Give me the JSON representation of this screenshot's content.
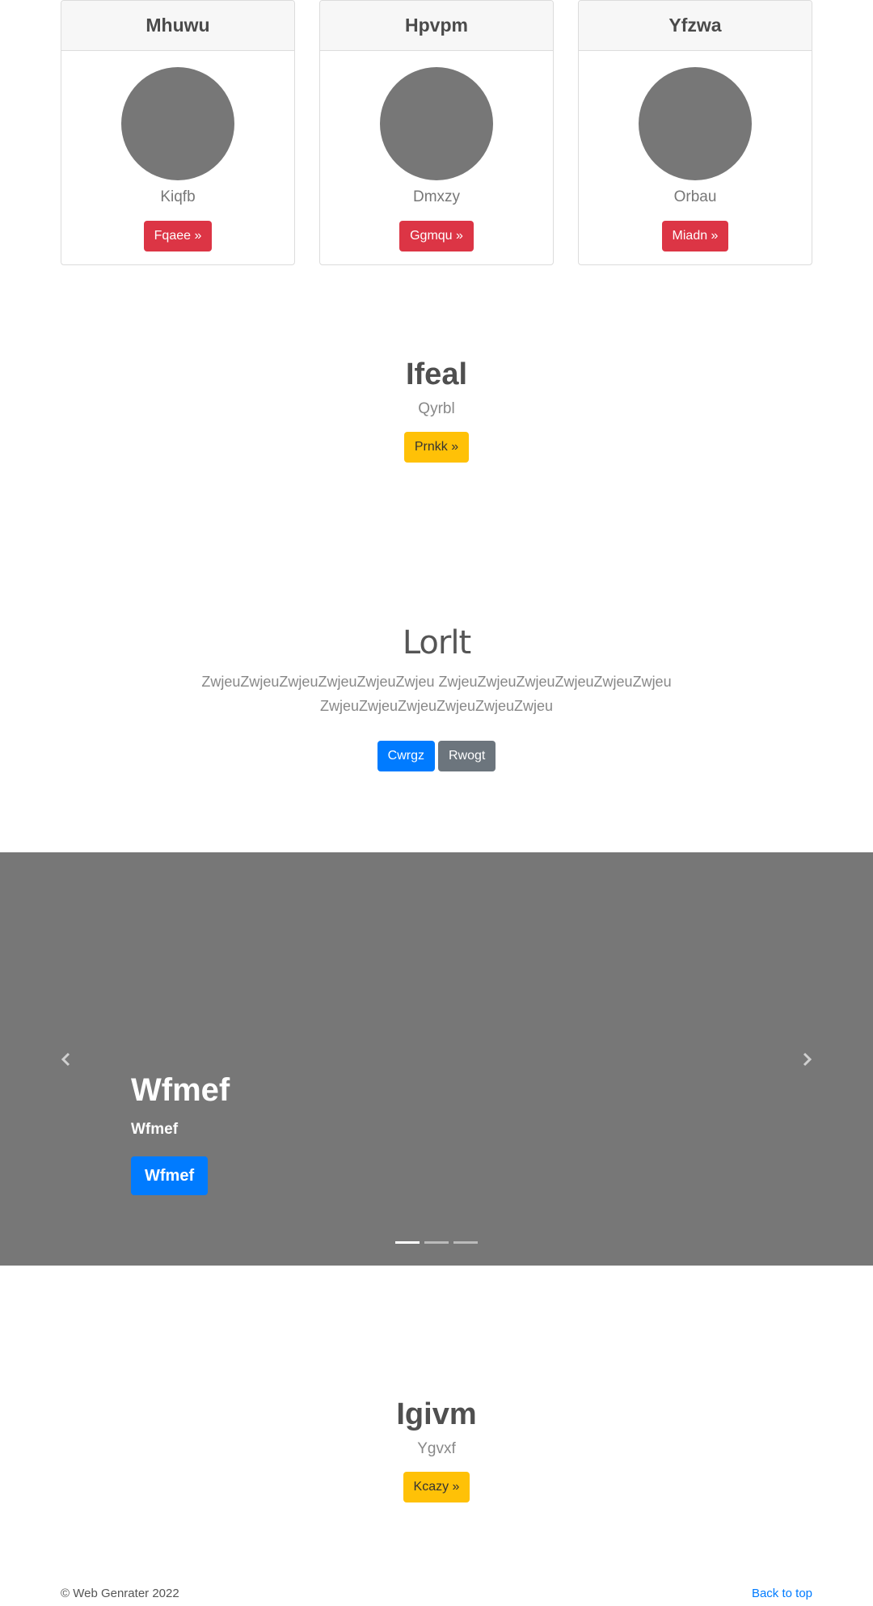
{
  "cards": [
    {
      "title": "Mhuwu",
      "subtitle": "Kiqfb",
      "button": "Fqaee »"
    },
    {
      "title": "Hpvpm",
      "subtitle": "Dmxzy",
      "button": "Ggmqu »"
    },
    {
      "title": "Yfzwa",
      "subtitle": "Orbau",
      "button": "Miadn »"
    }
  ],
  "feature1": {
    "heading": "Ifeal",
    "text": "Qyrbl",
    "button": "Prnkk »"
  },
  "jumbotron": {
    "heading": "Lorlt",
    "lead": "ZwjeuZwjeuZwjeuZwjeuZwjeuZwjeu ZwjeuZwjeuZwjeuZwjeuZwjeuZwjeu ZwjeuZwjeuZwjeuZwjeuZwjeuZwjeu",
    "primary_button": "Cwrgz",
    "secondary_button": "Rwogt"
  },
  "carousel": {
    "heading": "Wfmef",
    "text": "Wfmef",
    "button": "Wfmef",
    "prev_icon": "chevron-left-icon",
    "next_icon": "chevron-right-icon",
    "slide_count": 3,
    "active_slide": 1
  },
  "feature2": {
    "heading": "Igivm",
    "text": "Ygvxf",
    "button": "Kcazy »"
  },
  "footer": {
    "copyright": "© Web Genrater 2022",
    "back_to_top": "Back to top"
  },
  "colors": {
    "danger": "#dc3545",
    "warning": "#ffc107",
    "primary": "#007bff",
    "secondary": "#6c757d",
    "placeholder": "#777777"
  }
}
